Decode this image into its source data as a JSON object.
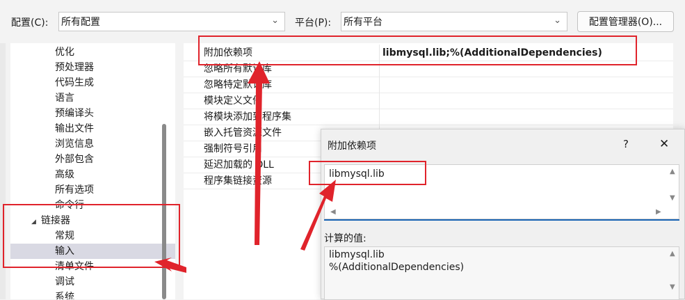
{
  "toolbar": {
    "config_label": "配置(C):",
    "config_value": "所有配置",
    "platform_label": "平台(P):",
    "platform_value": "所有平台",
    "config_manager_button": "配置管理器(O)..."
  },
  "tree": {
    "items": [
      {
        "label": "优化"
      },
      {
        "label": "预处理器"
      },
      {
        "label": "代码生成"
      },
      {
        "label": "语言"
      },
      {
        "label": "预编译头"
      },
      {
        "label": "输出文件"
      },
      {
        "label": "浏览信息"
      },
      {
        "label": "外部包含"
      },
      {
        "label": "高级"
      },
      {
        "label": "所有选项"
      },
      {
        "label": "命令行"
      },
      {
        "label": "链接器"
      },
      {
        "label": "常规"
      },
      {
        "label": "输入"
      },
      {
        "label": "清单文件"
      },
      {
        "label": "调试"
      },
      {
        "label": "系统"
      }
    ],
    "selected": "输入"
  },
  "grid": {
    "rows": [
      {
        "name": "附加依赖项",
        "value": "libmysql.lib;%(AdditionalDependencies)"
      },
      {
        "name": "忽略所有默认库",
        "value": ""
      },
      {
        "name": "忽略特定默认库",
        "value": ""
      },
      {
        "name": "模块定义文件",
        "value": ""
      },
      {
        "name": "将模块添加到程序集",
        "value": ""
      },
      {
        "name": "嵌入托管资源文件",
        "value": ""
      },
      {
        "name": "强制符号引用",
        "value": ""
      },
      {
        "name": "延迟加载的 DLL",
        "value": ""
      },
      {
        "name": "程序集链接资源",
        "value": ""
      }
    ]
  },
  "dialog": {
    "title": "附加依赖项",
    "help": "?",
    "close": "✕",
    "edit_value": "libmysql.lib",
    "computed_label": "计算的值:",
    "computed_lines": [
      "libmysql.lib",
      "%(AdditionalDependencies)"
    ]
  },
  "colors": {
    "annotation_red": "#e0232b",
    "selection": "#d9d9e3",
    "accent_blue": "#1a64b4"
  },
  "icons": {
    "tree_expand": "collapse-triangle-icon",
    "combo": "chevron-down-icon"
  }
}
